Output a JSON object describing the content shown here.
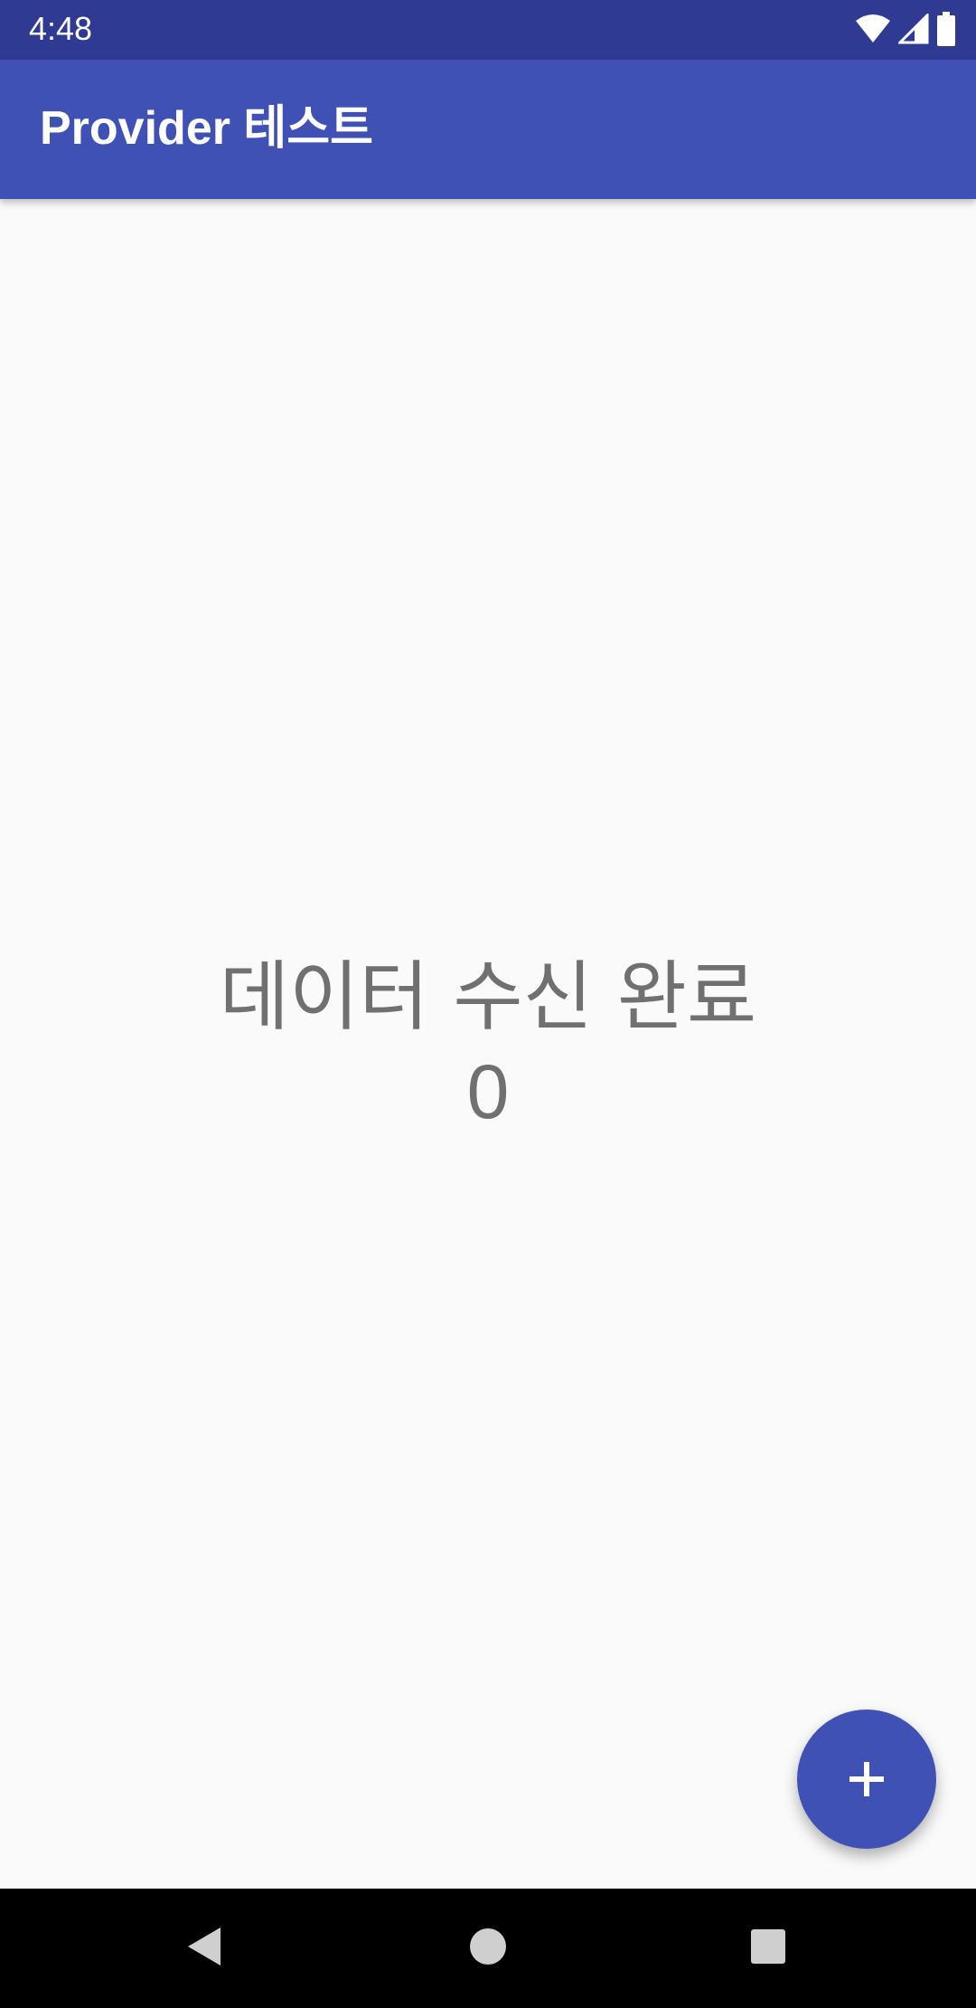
{
  "status_bar": {
    "time": "4:48",
    "icons": [
      "wifi-icon",
      "cell-signal-icon",
      "battery-icon"
    ]
  },
  "app_bar": {
    "title": "Provider 테스트"
  },
  "main": {
    "message": "데이터 수신 완료",
    "count": "0"
  },
  "fab": {
    "icon": "plus-icon"
  },
  "nav_bar": {
    "buttons": [
      "back-icon",
      "home-icon",
      "recents-icon"
    ]
  },
  "colors": {
    "primary": "#3f51b5",
    "primary_dark": "#2f3b93",
    "background": "#fafafa",
    "text_gray": "#707070"
  }
}
